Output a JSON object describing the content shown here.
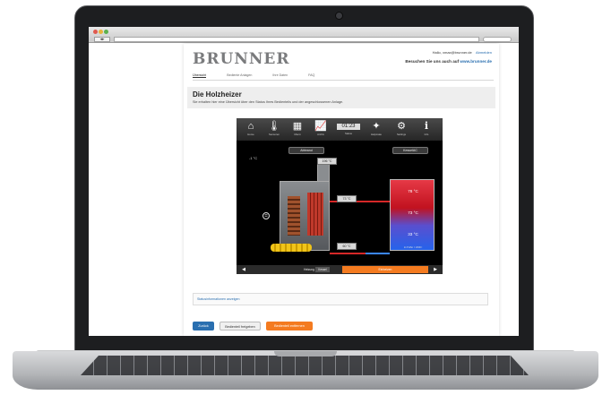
{
  "header": {
    "logo": "BRUNNER",
    "user_line": "Hallo, xmax@brunner.de",
    "logout": "Abmelden",
    "visit_prefix": "Besuchen Sie uns auch auf",
    "visit_link": "www.brunner.de"
  },
  "tabs": [
    "Übersicht",
    "Bediente Anlagen",
    "Ihre Daten",
    "FAQ"
  ],
  "page": {
    "title": "Die Holzheizer",
    "subtitle": "Sie erhalten hier eine Übersicht über den Status Ihres Bedienteils und der angeschlossenen Anlage."
  },
  "panel": {
    "toolbar": [
      {
        "icon": "home-icon",
        "glyph": "⌂",
        "label": "Home"
      },
      {
        "icon": "thermometer-icon",
        "glyph": "🌡",
        "label": "Sensoren"
      },
      {
        "icon": "menu-icon",
        "glyph": "▦",
        "label": "Menü"
      },
      {
        "icon": "chart-icon",
        "glyph": "📈",
        "label": "Archiv"
      },
      {
        "icon": "clock-icon",
        "glyph": "▭",
        "label": "Status"
      },
      {
        "icon": "wand-icon",
        "glyph": "✦",
        "label": "Helpmate"
      },
      {
        "icon": "settings-icon",
        "glyph": "⚙",
        "label": "Settings"
      },
      {
        "icon": "info-icon",
        "glyph": "i",
        "label": "Info"
      }
    ],
    "toolbar_clock": "01:23",
    "btn_abbrand": "Abbrand",
    "btn_kessel": "KesselAC",
    "outside_temp": "-1 °C",
    "t_top": "196 °C",
    "t_mid": "73 °C",
    "t_low": "60 °C",
    "tank_temps": [
      "78 °C",
      "73 °C",
      "33 °C"
    ],
    "tank_note": "2x Puffer = 2000 l",
    "bottom_heat": "Heizung",
    "bottom_mode": "Kessel",
    "bottom_action": "Einheizen",
    "colors": {
      "accent": "#f47b20",
      "link": "#2a6fb0",
      "hot": "#d62828",
      "cold": "#2563eb"
    }
  },
  "info_link": "Statusinformationen anzeigen",
  "actions": {
    "back": "Zurück",
    "share": "Bedienteil freigeben",
    "remove": "Bedienteil entfernen"
  }
}
